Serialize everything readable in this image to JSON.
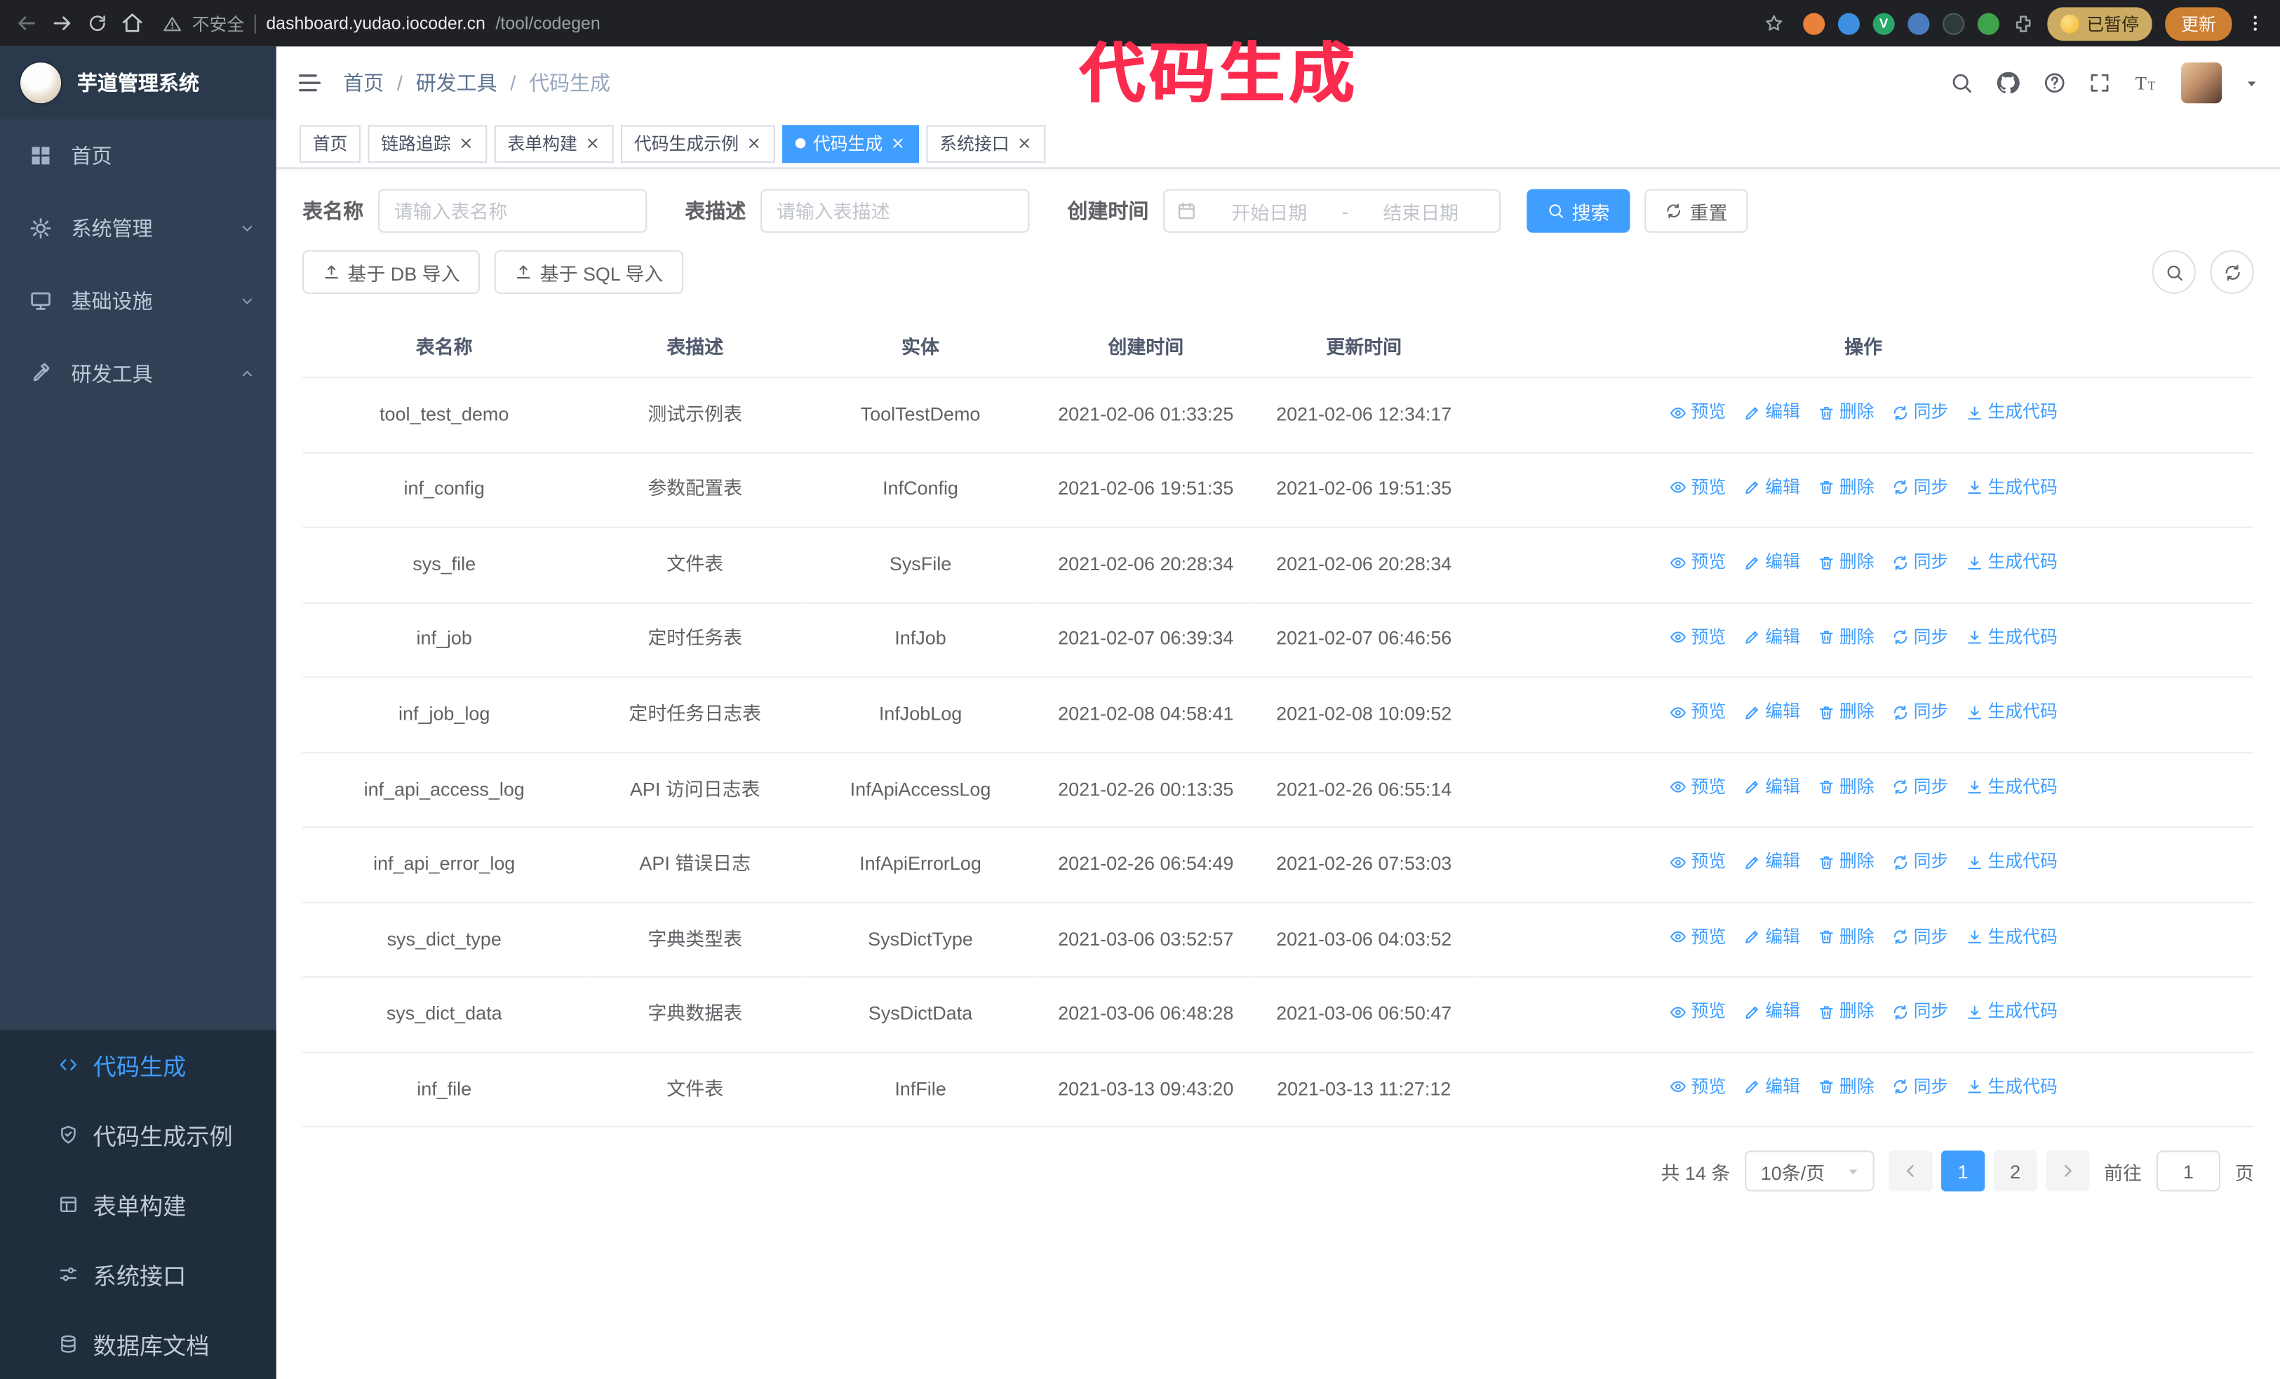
{
  "annotation": {
    "text": "代码生成",
    "color": "#fb2b4e"
  },
  "browser": {
    "warning_text": "不安全",
    "url_host": "dashboard.yudao.iocoder.cn",
    "url_path": "/tool/codegen",
    "paused_badge": "已暂停",
    "update_button": "更新"
  },
  "sidebar": {
    "logo_title": "芋道管理系统",
    "items": [
      {
        "label": "首页",
        "icon": "home-icon"
      },
      {
        "label": "系统管理",
        "icon": "gear-icon",
        "chevron_icon": "chevron-down-icon"
      },
      {
        "label": "基础设施",
        "icon": "infra-icon",
        "chevron_icon": "chevron-down-icon"
      },
      {
        "label": "研发工具",
        "icon": "tools-icon",
        "chevron_icon": "chevron-up-icon",
        "expanded": true
      }
    ],
    "submenu": [
      {
        "label": "代码生成",
        "icon": "code-icon",
        "active": true
      },
      {
        "label": "代码生成示例",
        "icon": "example-icon"
      },
      {
        "label": "表单构建",
        "icon": "form-icon"
      },
      {
        "label": "系统接口",
        "icon": "api-icon"
      },
      {
        "label": "数据库文档",
        "icon": "dbdoc-icon"
      }
    ]
  },
  "navbar": {
    "breadcrumb": [
      {
        "label": "首页"
      },
      {
        "label": "研发工具",
        "sep": "/"
      },
      {
        "label": "代码生成",
        "sep": "/",
        "current": true
      }
    ]
  },
  "tabs": [
    {
      "label": "首页"
    },
    {
      "label": "链路追踪",
      "closable": true
    },
    {
      "label": "表单构建",
      "closable": true
    },
    {
      "label": "代码生成示例",
      "closable": true
    },
    {
      "label": "代码生成",
      "closable": true,
      "active": true
    },
    {
      "label": "系统接口",
      "closable": true
    }
  ],
  "filters": {
    "table_name_label": "表名称",
    "table_name_placeholder": "请输入表名称",
    "table_desc_label": "表描述",
    "table_desc_placeholder": "请输入表描述",
    "create_time_label": "创建时间",
    "date_start_placeholder": "开始日期",
    "date_separator": "-",
    "date_end_placeholder": "结束日期",
    "search_button": "搜索",
    "reset_button": "重置"
  },
  "toolbar": {
    "import_db_button": "基于 DB 导入",
    "import_sql_button": "基于 SQL 导入"
  },
  "table": {
    "columns": [
      "表名称",
      "表描述",
      "实体",
      "创建时间",
      "更新时间",
      "操作"
    ],
    "actions": [
      {
        "name": "preview",
        "label": "预览",
        "icon": "eye-icon"
      },
      {
        "name": "edit",
        "label": "编辑",
        "icon": "edit-icon"
      },
      {
        "name": "delete",
        "label": "删除",
        "icon": "delete-icon"
      },
      {
        "name": "sync",
        "label": "同步",
        "icon": "sync-icon"
      },
      {
        "name": "generate",
        "label": "生成代码",
        "icon": "generate-icon"
      }
    ],
    "rows": [
      {
        "name": "tool_test_demo",
        "desc": "测试示例表",
        "entity": "ToolTestDemo",
        "created": "2021-02-06 01:33:25",
        "updated": "2021-02-06 12:34:17"
      },
      {
        "name": "inf_config",
        "desc": "参数配置表",
        "entity": "InfConfig",
        "created": "2021-02-06 19:51:35",
        "updated": "2021-02-06 19:51:35"
      },
      {
        "name": "sys_file",
        "desc": "文件表",
        "entity": "SysFile",
        "created": "2021-02-06 20:28:34",
        "updated": "2021-02-06 20:28:34"
      },
      {
        "name": "inf_job",
        "desc": "定时任务表",
        "entity": "InfJob",
        "created": "2021-02-07 06:39:34",
        "updated": "2021-02-07 06:46:56"
      },
      {
        "name": "inf_job_log",
        "desc": "定时任务日志表",
        "entity": "InfJobLog",
        "created": "2021-02-08 04:58:41",
        "updated": "2021-02-08 10:09:52"
      },
      {
        "name": "inf_api_access_log",
        "desc": "API 访问日志表",
        "entity": "InfApiAccessLog",
        "created": "2021-02-26 00:13:35",
        "updated": "2021-02-26 06:55:14"
      },
      {
        "name": "inf_api_error_log",
        "desc": "API 错误日志",
        "entity": "InfApiErrorLog",
        "created": "2021-02-26 06:54:49",
        "updated": "2021-02-26 07:53:03"
      },
      {
        "name": "sys_dict_type",
        "desc": "字典类型表",
        "entity": "SysDictType",
        "created": "2021-03-06 03:52:57",
        "updated": "2021-03-06 04:03:52"
      },
      {
        "name": "sys_dict_data",
        "desc": "字典数据表",
        "entity": "SysDictData",
        "created": "2021-03-06 06:48:28",
        "updated": "2021-03-06 06:50:47"
      },
      {
        "name": "inf_file",
        "desc": "文件表",
        "entity": "InfFile",
        "created": "2021-03-13 09:43:20",
        "updated": "2021-03-13 11:27:12"
      }
    ]
  },
  "pagination": {
    "total_text": "共 14 条",
    "page_size_text": "10条/页",
    "pages": [
      {
        "label": "1",
        "active": true
      },
      {
        "label": "2"
      }
    ],
    "goto_prefix": "前往",
    "goto_value": "1",
    "goto_suffix": "页"
  },
  "colors": {
    "accent": "#409eff",
    "sidebar_bg": "#304156",
    "submenu_bg": "#1f2d3d"
  }
}
